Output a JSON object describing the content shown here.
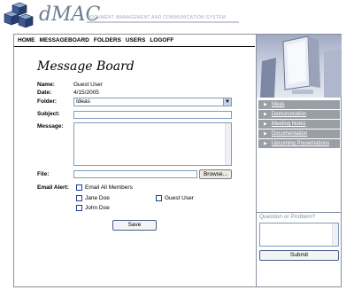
{
  "header": {
    "logo_text": "dMAC",
    "tagline": "DOCUMENT MANAGEMENT AND COMMUNICATION SYSTEM"
  },
  "nav": {
    "items": [
      "HOME",
      "MESSAGEBOARD",
      "FOLDERS",
      "USERS",
      "LOGOFF"
    ]
  },
  "form": {
    "title": "Message Board",
    "name_label": "Name:",
    "name_value": "Guest User",
    "date_label": "Date:",
    "date_value": "4/15/2005",
    "folder_label": "Folder:",
    "folder_value": "Ideas",
    "subject_label": "Subject:",
    "subject_value": "",
    "message_label": "Message:",
    "message_value": "",
    "file_label": "File:",
    "browse_label": "Browse...",
    "email_alert_label": "Email Alert:",
    "checkboxes": [
      "Email All Members",
      "Jane Doe",
      "John Doe",
      "Guest User"
    ],
    "save_label": "Save"
  },
  "sidebar": {
    "links": [
      "Ideas",
      "Demonstration",
      "Meeting Notes",
      "Documentation",
      "Upcoming Presentations"
    ],
    "question_label": "Question or Problem?",
    "submit_label": "Submit"
  },
  "colors": {
    "logo": "#6b7c93",
    "nav_link_bg": "#9a9fa6",
    "frame_border": "#8a8f9c",
    "input_border": "#7f9db9"
  }
}
